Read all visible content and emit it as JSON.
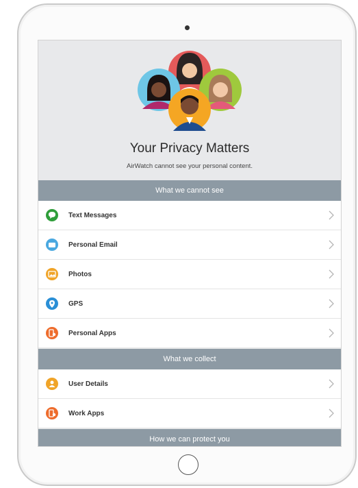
{
  "header": {
    "title": "Your Privacy Matters",
    "subtitle": "AirWatch cannot see your personal content."
  },
  "sections": [
    {
      "heading": "What we cannot see",
      "items": [
        {
          "label": "Text Messages",
          "icon": "chat-bubble-icon",
          "color": "#2f9e3a"
        },
        {
          "label": "Personal Email",
          "icon": "envelope-icon",
          "color": "#4aa8e0"
        },
        {
          "label": "Photos",
          "icon": "photo-icon",
          "color": "#f0a428"
        },
        {
          "label": "GPS",
          "icon": "location-pin-icon",
          "color": "#2a8fd6"
        },
        {
          "label": "Personal Apps",
          "icon": "apps-icon",
          "color": "#ee6c2c"
        }
      ]
    },
    {
      "heading": "What we collect",
      "items": [
        {
          "label": "User Details",
          "icon": "user-icon",
          "color": "#f0a428"
        },
        {
          "label": "Work Apps",
          "icon": "apps-icon",
          "color": "#ee6c2c"
        }
      ]
    },
    {
      "heading": "How we can protect you",
      "items": []
    }
  ],
  "colors": {
    "section_bar": "#8d9aa4",
    "header_bg": "#e8e9eb"
  }
}
